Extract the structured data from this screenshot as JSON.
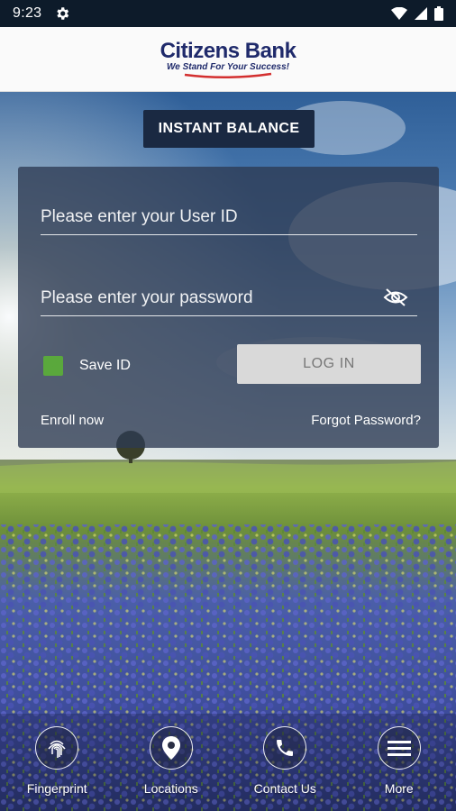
{
  "status_bar": {
    "time": "9:23",
    "icons": [
      "gear-icon",
      "wifi-icon",
      "signal-icon",
      "battery-icon"
    ]
  },
  "header": {
    "brand_name": "Citizens Bank",
    "tagline": "We Stand For Your Success!",
    "brand_color": "#1f2a6b",
    "accent_color": "#d32f2f"
  },
  "instant_balance": {
    "label": "INSTANT BALANCE"
  },
  "login": {
    "user_id_placeholder": "Please enter your User ID",
    "user_id_value": "",
    "password_placeholder": "Please enter your password",
    "password_value": "",
    "save_id_label": "Save ID",
    "save_id_checked": true,
    "login_label": "LOG IN",
    "enroll_label": "Enroll now",
    "forgot_label": "Forgot Password?"
  },
  "nav": {
    "items": [
      {
        "label": "Fingerprint",
        "icon": "fingerprint-icon"
      },
      {
        "label": "Locations",
        "icon": "location-pin-icon"
      },
      {
        "label": "Contact Us",
        "icon": "phone-icon"
      },
      {
        "label": "More",
        "icon": "menu-icon"
      }
    ]
  },
  "colors": {
    "status_bar": "#0d1b2a",
    "card_bg": "rgba(45,58,82,0.78)",
    "checkbox": "#5aa83c",
    "login_button": "#d9d9d9"
  }
}
